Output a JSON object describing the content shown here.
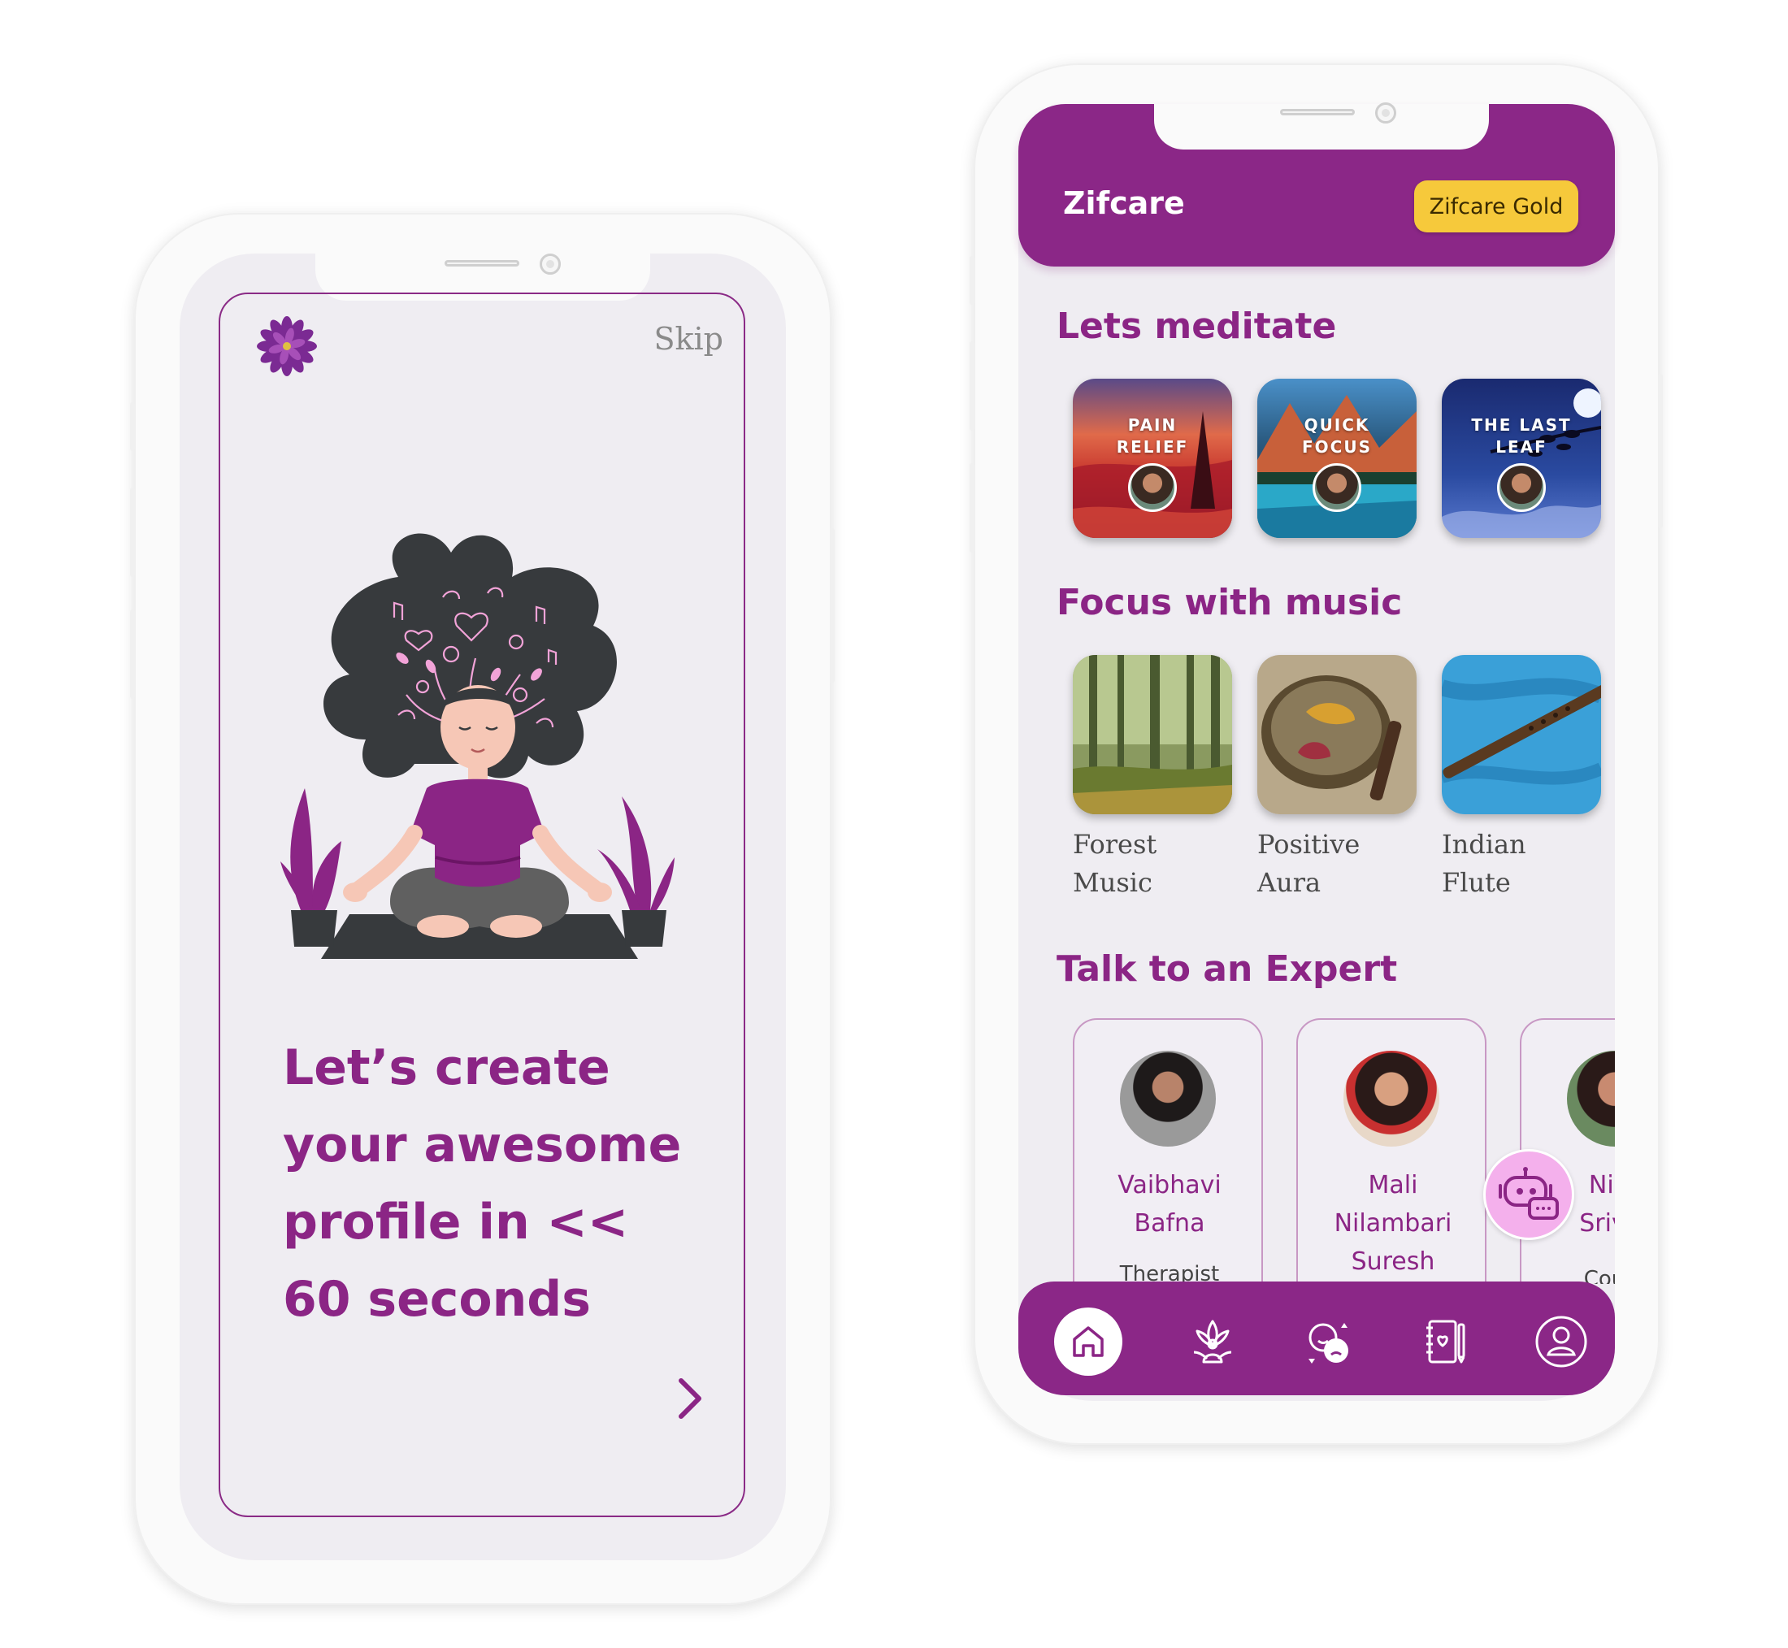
{
  "onboarding": {
    "skip_label": "Skip",
    "headline_lines": [
      "Let’s create",
      "your awesome",
      "profile in <<",
      "60 seconds"
    ],
    "next_icon": "chevron-right-icon",
    "logo_icon": "purple-flower-logo"
  },
  "home": {
    "app_name": "Zifcare",
    "gold_button": "Zifcare Gold",
    "sections": {
      "meditate": "Lets meditate",
      "music": "Focus with music",
      "expert": "Talk to an Expert"
    },
    "meditations": [
      {
        "line1": "PAIN",
        "line2": "RELIEF"
      },
      {
        "line1": "QUICK",
        "line2": "FOCUS"
      },
      {
        "line1": "THE LAST",
        "line2": "LEAF"
      }
    ],
    "music": [
      {
        "line1": "Forest",
        "line2": "Music"
      },
      {
        "line1": "Positive",
        "line2": "Aura"
      },
      {
        "line1": "Indian Flute",
        "line2": ""
      }
    ],
    "experts": [
      {
        "line1": "Vaibhavi",
        "line2": "Bafna",
        "line3": "",
        "role": "Therapist"
      },
      {
        "line1": "Mali",
        "line2": "Nilambari",
        "line3": "Suresh",
        "role": ""
      },
      {
        "line1": "Niha",
        "line2": "Srivas",
        "line3": "",
        "role": "Couns"
      }
    ],
    "nav_icons": [
      "home-icon",
      "lotus-meditation-icon",
      "mood-icon",
      "journal-icon",
      "profile-icon"
    ],
    "chat_icon": "chatbot-icon"
  },
  "colors": {
    "brand_purple": "#8b2787",
    "screen_bg": "#efedf2",
    "gold": "#f6c93b"
  }
}
